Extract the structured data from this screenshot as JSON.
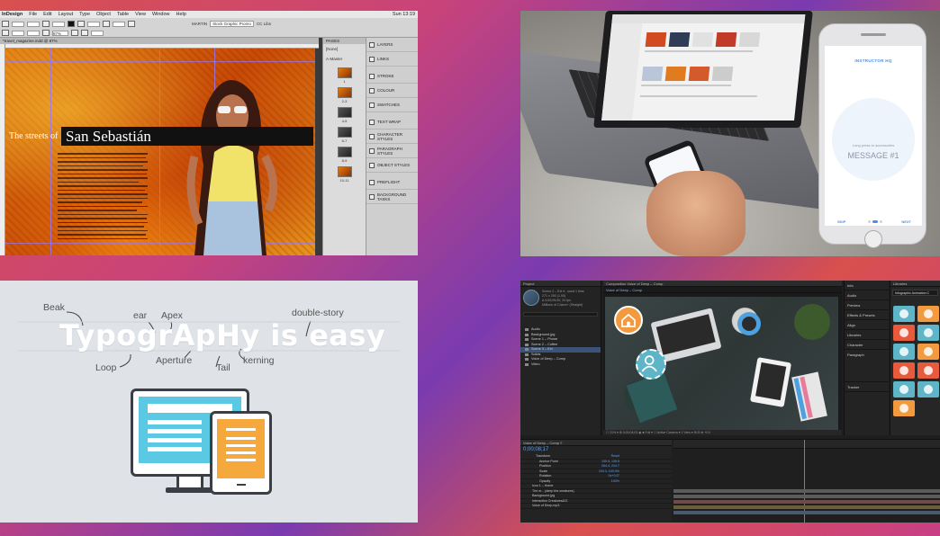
{
  "colors": {
    "bg_pink": "#d9504e",
    "bg_purple": "#7a3bb0",
    "accent_blue": "#4a90e2",
    "monitor_cyan": "#5bc8e4",
    "tablet_orange": "#f5a83c",
    "ae_icon_orange": "#f39a3e",
    "ae_icon_teal": "#5fb5c8"
  },
  "indesign": {
    "menubar": {
      "app": "InDesign",
      "items": [
        "File",
        "Edit",
        "Layout",
        "Type",
        "Object",
        "Table",
        "View",
        "Window",
        "Help"
      ],
      "right": "Sun 13:19"
    },
    "control": {
      "zoom": "87%",
      "workspace": "MARTIN",
      "search_placeholder": "Stock Graphic Promo",
      "cc_libs": "CC Libs"
    },
    "doc_tab": "*travel_magazine.indd @ 87%",
    "title_pre": "The streets of",
    "title_main": "San Sebastián",
    "pages_panel": {
      "header": "PAGES",
      "items": [
        "[None]",
        "A-Master"
      ],
      "page_labels": [
        "1",
        "2-3",
        "4-5",
        "6-7",
        "8-9",
        "10-11"
      ]
    },
    "panels": [
      "LAYERS",
      "LINKS",
      "STROKE",
      "COLOUR",
      "SWATCHES",
      "TEXT WRAP",
      "CHARACTER STYLES",
      "PARAGRAPH STYLES",
      "OBJECT STYLES",
      "PREFLIGHT",
      "BACKGROUND TASKS"
    ]
  },
  "phone": {
    "header": "INSTRUCTOR HQ",
    "sub": "Long press to accessories",
    "message": "MESSAGE #1",
    "skip": "SKIP",
    "next": "NEXT"
  },
  "typography": {
    "title": "TypogrApHy is easy",
    "labels": {
      "beak": "Beak",
      "ear": "ear",
      "apex": "Apex",
      "double_story": "double-story",
      "loop": "Loop",
      "aperture": "Aperture",
      "tail": "Tail",
      "kerning": "kerning"
    }
  },
  "aftereffects": {
    "project_tab": "Project",
    "comp_tab": "Composition Voice of Deep – Comp",
    "comp_subtab": "Voice of Deep – Comp",
    "proj_meta": [
      "Scene 2 – Ext ▾ , used 1 time",
      "271 x 250 (1.00)",
      "Δ 0;00;05;00, 24 fps",
      "Millions of Colors+ (Straight)"
    ],
    "project_items": [
      "Audio",
      "Background.jpg",
      "Scene 1 – Phone",
      "Scene 2 – Coffee",
      "Scene 3 – Ext",
      "Solids",
      "Voice of Deep – Comp",
      "Video"
    ],
    "right_panels": [
      "Info",
      "Audio",
      "Preview",
      "Effects & Presets",
      "Align",
      "Libraries",
      "Character",
      "Paragraph",
      "Tracker"
    ],
    "libraries": {
      "header": "Libraries",
      "library": "Infographic Animation C"
    },
    "viewer_bar": "☐ 21% ▾  ⊞  0;00;04;03  ◉  ♣  Full  ▾  ☐  Active Camera  ▾  1 View  ▾  ⊞  ⊟  ⊕  +0.0",
    "timeline_tab": "Voice of Deep – Comp ≡",
    "timecode": "0;00;08;17",
    "layers": [
      "Transform",
      "Anchor Point",
      "Position",
      "Scale",
      "Rotation",
      "Opacity",
      "Icon 1 – Home",
      "The m... (deep the creatures)",
      "Background.jpg",
      "Interaction Creatures&Cl",
      "Voice of Deep.mp3"
    ],
    "layer_values": [
      "Reset",
      "135.5, 135.5",
      "264.4, 224.7",
      "100.0, 100.0%",
      "0x+0.0°",
      "100%"
    ]
  }
}
